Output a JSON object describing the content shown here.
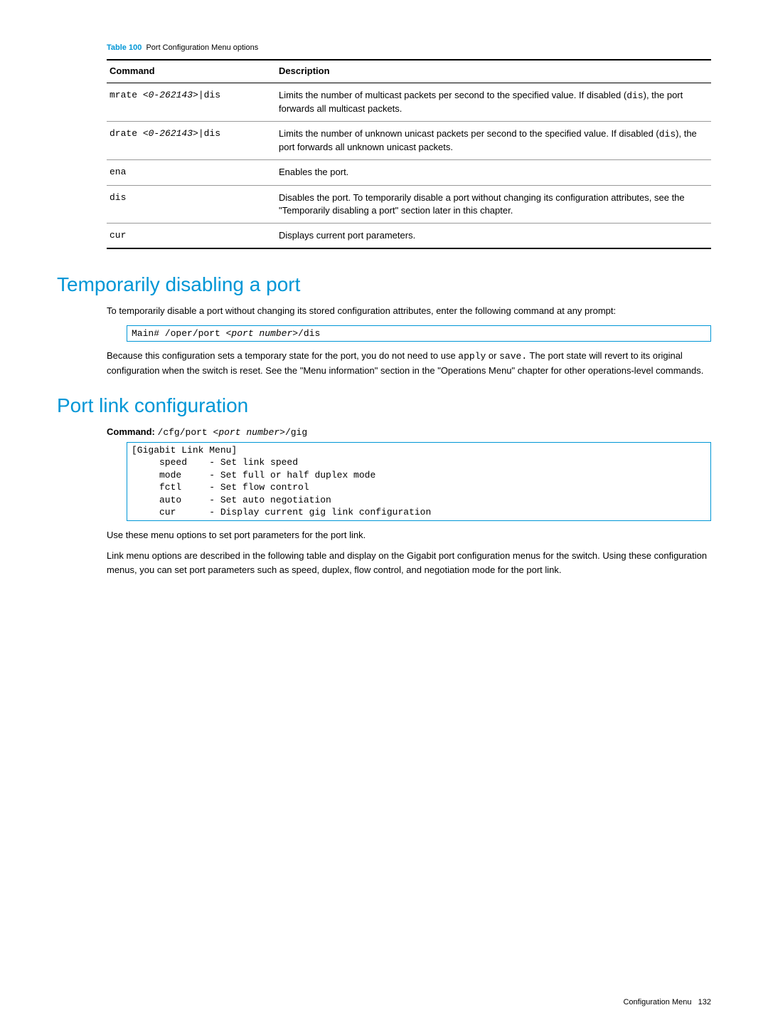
{
  "table": {
    "label": "Table 100",
    "caption": "Port Configuration Menu options",
    "headers": [
      "Command",
      "Description"
    ],
    "rows": [
      {
        "cmd_prefix": "mrate ",
        "cmd_arg": "<0-262143>",
        "cmd_suffix": "|dis",
        "desc_pre": "Limits the number of multicast packets per second to the specified value. If disabled (",
        "desc_code": "dis",
        "desc_post": "), the port forwards all multicast packets."
      },
      {
        "cmd_prefix": "drate ",
        "cmd_arg": "<0-262143>",
        "cmd_suffix": "|dis",
        "desc_pre": "Limits the number of unknown unicast packets per second to the specified value. If disabled (",
        "desc_code": "dis",
        "desc_post": "), the port forwards all unknown unicast packets."
      },
      {
        "cmd_prefix": "ena",
        "desc_pre": "Enables the port."
      },
      {
        "cmd_prefix": "dis",
        "desc_pre": "Disables the port. To temporarily disable a port without changing its configuration attributes, see the \"Temporarily disabling a port\" section later in this chapter."
      },
      {
        "cmd_prefix": "cur",
        "desc_pre": "Displays current port parameters."
      }
    ]
  },
  "section1": {
    "heading": "Temporarily disabling a port",
    "para1": "To temporarily disable a port without changing its stored configuration attributes, enter the following command at any prompt:",
    "code_pre": "Main# /oper/port ",
    "code_arg": "<port number>",
    "code_post": "/dis",
    "para2_pre": "Because this configuration sets a temporary state for the port, you do not need to use ",
    "para2_code1": "apply",
    "para2_mid": " or ",
    "para2_code2": "save.",
    "para2_post": " The port state will revert to its original configuration when the switch is reset. See the \"Menu information\" section in the \"Operations Menu\" chapter for other operations-level commands."
  },
  "section2": {
    "heading": "Port link configuration",
    "cmd_label": "Command:",
    "cmd_pre": "/cfg/port ",
    "cmd_arg": "<port number>",
    "cmd_post": "/gig",
    "codebox": "[Gigabit Link Menu]\n     speed    - Set link speed\n     mode     - Set full or half duplex mode\n     fctl     - Set flow control\n     auto     - Set auto negotiation\n     cur      - Display current gig link configuration",
    "para1": "Use these menu options to set port parameters for the port link.",
    "para2": "Link menu options are described in the following table and display on the Gigabit port configuration menus for the switch. Using these configuration menus, you can set port parameters such as speed, duplex, flow control, and negotiation mode for the port link."
  },
  "footer": {
    "section": "Configuration Menu",
    "page": "132"
  }
}
